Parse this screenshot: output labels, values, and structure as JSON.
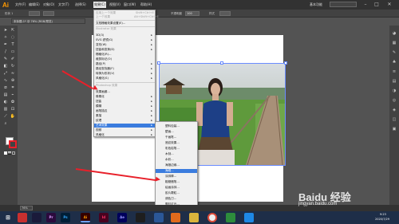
{
  "app": {
    "logo": "Ai",
    "workspace_label": "基本功能"
  },
  "menubar": {
    "items": [
      "文件(F)",
      "编辑(E)",
      "对象(O)",
      "文字(T)",
      "选择(S)",
      "效果(C)",
      "视图(V)",
      "窗口(W)",
      "帮助(H)"
    ]
  },
  "controlbar": {
    "label": "形状 1",
    "opacity_label": "不透明度",
    "style_label": "样式",
    "value": "100"
  },
  "document_tab": {
    "title": "未标题-1* @ 76% (RGB/预览)"
  },
  "effects_menu": {
    "items": [
      {
        "label": "应用上一个效果",
        "shortcut": "Shift+Ctrl+E",
        "disabled": true
      },
      {
        "label": "上一个效果",
        "shortcut": "Alt+Shift+Ctrl+E",
        "disabled": true
      },
      {
        "label": "文档栅格效果设置(E)...",
        "disabled": false
      },
      {
        "label": "Illustrator 效果",
        "disabled": true,
        "header": true
      },
      {
        "label": "3D(3)",
        "submenu": true
      },
      {
        "label": "SVG 滤镜(G)",
        "submenu": true
      },
      {
        "label": "变形(W)",
        "submenu": true
      },
      {
        "label": "扭曲和变换(D)",
        "submenu": true
      },
      {
        "label": "栅格化(R)...",
        "submenu": false
      },
      {
        "label": "裁剪标记(O)",
        "submenu": false
      },
      {
        "label": "路径(P)",
        "submenu": true
      },
      {
        "label": "路径查找器(F)",
        "submenu": true
      },
      {
        "label": "转换为形状(V)",
        "submenu": true
      },
      {
        "label": "风格化(S)",
        "submenu": true
      },
      {
        "label": "Photoshop 效果",
        "disabled": true,
        "header": true
      },
      {
        "label": "效果画廊...",
        "submenu": false
      },
      {
        "label": "像素化",
        "submenu": true
      },
      {
        "label": "扭曲",
        "submenu": true
      },
      {
        "label": "模糊",
        "submenu": true
      },
      {
        "label": "画笔描边",
        "submenu": true
      },
      {
        "label": "素描",
        "submenu": true
      },
      {
        "label": "纹理",
        "submenu": true
      },
      {
        "label": "艺术效果",
        "submenu": true,
        "highlighted": true
      },
      {
        "label": "视频",
        "submenu": true
      },
      {
        "label": "风格化",
        "submenu": true
      }
    ]
  },
  "artistic_submenu": {
    "items": [
      {
        "label": "塑料包装..."
      },
      {
        "label": "壁画..."
      },
      {
        "label": "干画笔..."
      },
      {
        "label": "底纹效果..."
      },
      {
        "label": "彩色铅笔..."
      },
      {
        "label": "木刻..."
      },
      {
        "label": "水彩..."
      },
      {
        "label": "海报边缘..."
      },
      {
        "label": "海绵...",
        "highlighted": true
      },
      {
        "label": "涂抹棒..."
      },
      {
        "label": "粗糙蜡笔..."
      },
      {
        "label": "绘画涂抹..."
      },
      {
        "label": "胶片颗粒..."
      },
      {
        "label": "调色刀..."
      },
      {
        "label": "霓虹灯光..."
      }
    ]
  },
  "statusbar": {
    "zoom": "76%"
  },
  "taskbar": {
    "time": "9:23",
    "date": "2020/7/29"
  },
  "watermark": {
    "text": "Baidu 经验",
    "url": "jingyan.baidu.com"
  },
  "colors": {
    "highlight": "#3b7cde",
    "arrow": "#e8202a",
    "taskbar": "#1e2e48"
  },
  "icons": [
    "selection-tool-icon",
    "direct-selection-icon",
    "pen-icon",
    "type-icon",
    "line-icon",
    "rectangle-icon",
    "brush-icon",
    "pencil-icon",
    "eraser-icon",
    "rotate-icon",
    "scale-icon",
    "width-icon",
    "warp-icon",
    "shape-builder-icon",
    "perspective-icon",
    "mesh-icon",
    "gradient-icon",
    "eyedropper-icon",
    "blend-icon",
    "symbol-icon",
    "graph-icon",
    "artboard-icon",
    "slice-icon",
    "hand-icon",
    "zoom-icon"
  ]
}
